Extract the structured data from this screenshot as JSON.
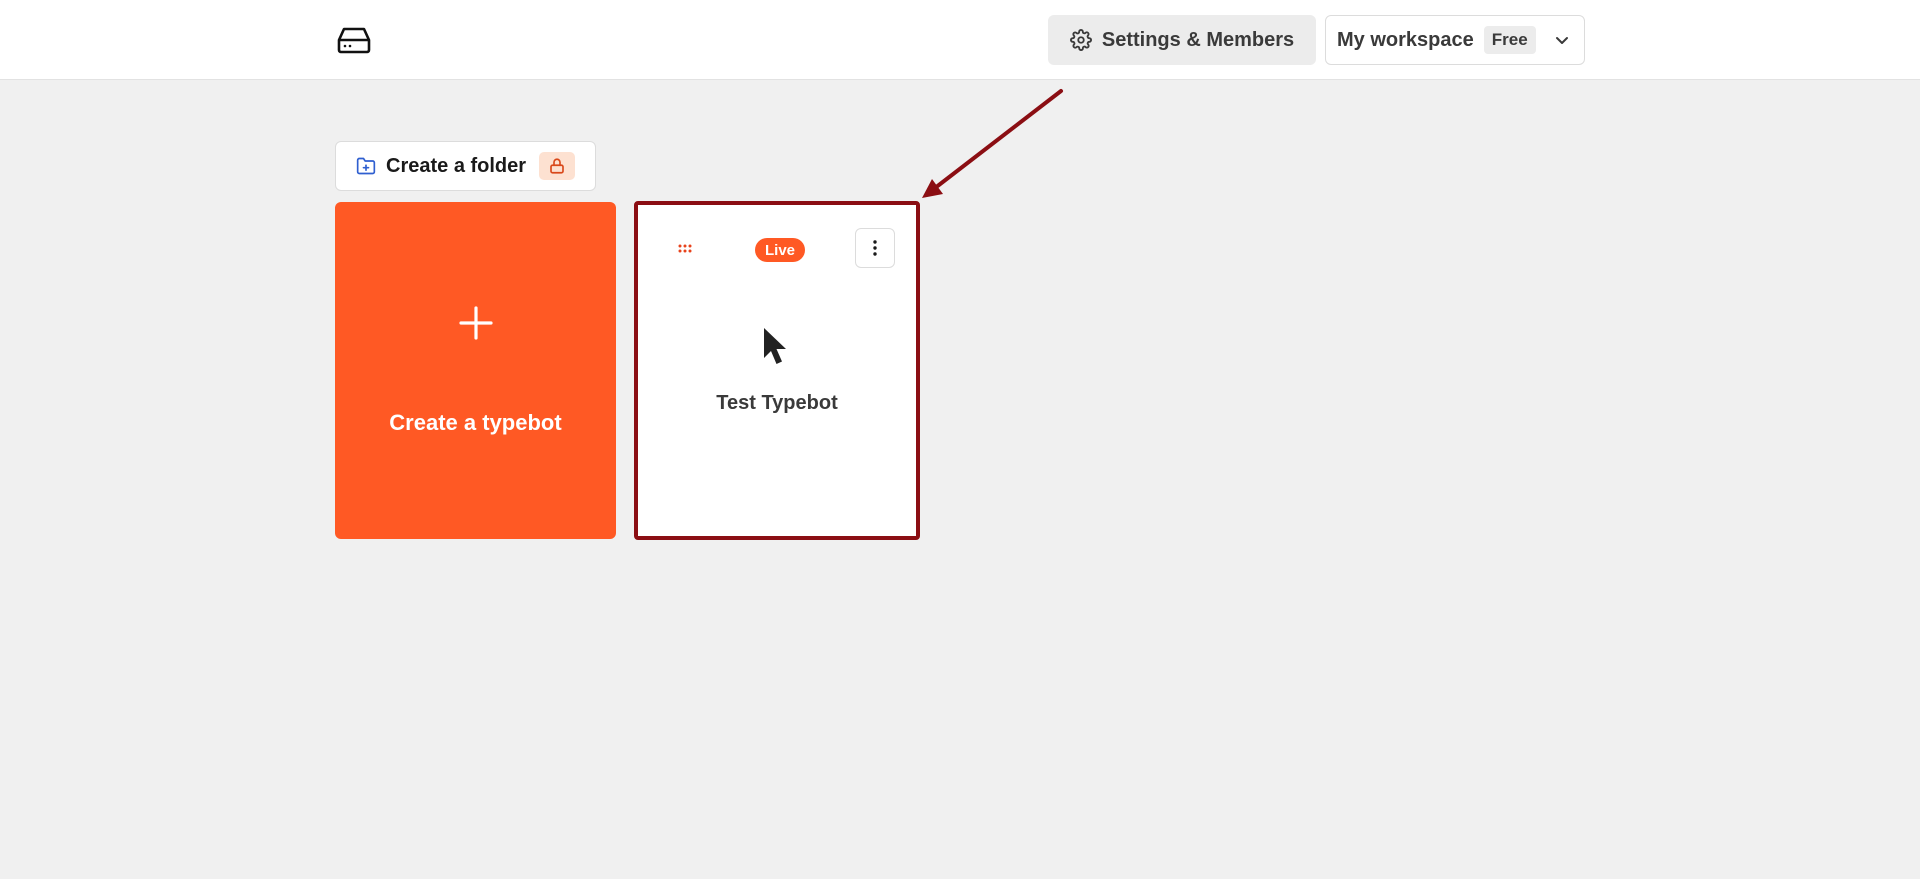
{
  "header": {
    "logo_icon": "hard-drive-icon",
    "settings_label": "Settings & Members",
    "settings_icon": "gear-icon",
    "workspace": {
      "name": "My workspace",
      "plan": "Free",
      "chevron_icon": "chevron-down-icon"
    }
  },
  "toolbar": {
    "create_folder_label": "Create a folder",
    "folder_icon": "folder-plus-icon",
    "lock_icon": "lock-icon"
  },
  "create_card": {
    "label": "Create a typebot",
    "icon": "plus-icon"
  },
  "typebots": [
    {
      "name": "Test Typebot",
      "status": "Live",
      "drag_icon": "drag-handle-icon",
      "menu_icon": "more-vertical-icon",
      "bot_icon": "cursor-arrow-icon"
    }
  ],
  "colors": {
    "accent": "#ff5924",
    "annotation": "#8b0e13",
    "background": "#f0f0f0",
    "lock_badge_bg": "#fde1d1",
    "folder_icon": "#2f5fd0"
  }
}
